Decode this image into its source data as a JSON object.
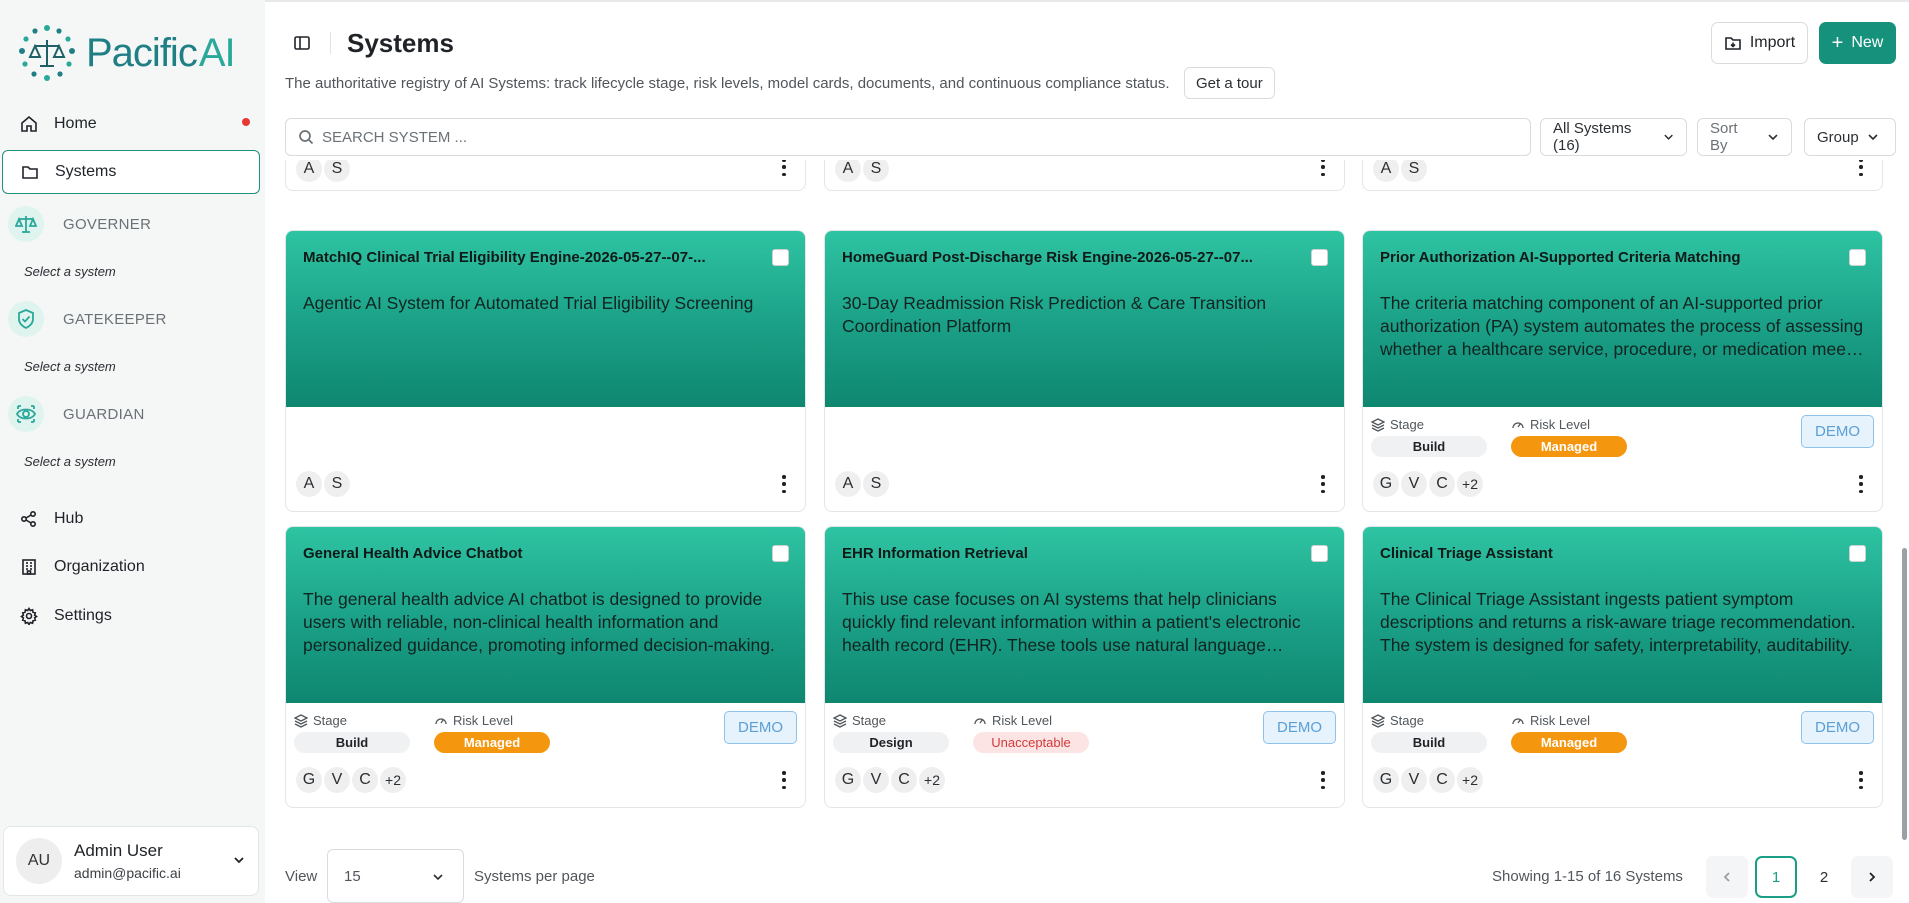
{
  "brand": {
    "name_part1": "Pacific",
    "name_part2": "AI"
  },
  "sidebar": {
    "nav": [
      {
        "label": "Home",
        "icon": "home-icon",
        "has_notification": true
      },
      {
        "label": "Systems",
        "icon": "folder-icon",
        "active": true
      }
    ],
    "modules": [
      {
        "label": "GOVERNER",
        "icon": "scale-icon",
        "sub": "Select a system"
      },
      {
        "label": "GATEKEEPER",
        "icon": "shield-check-icon",
        "sub": "Select a system"
      },
      {
        "label": "GUARDIAN",
        "icon": "eye-shield-icon",
        "sub": "Select a system"
      }
    ],
    "bottom_nav": [
      {
        "label": "Hub",
        "icon": "share-nodes-icon"
      },
      {
        "label": "Organization",
        "icon": "building-icon"
      },
      {
        "label": "Settings",
        "icon": "gear-icon"
      }
    ],
    "user": {
      "initials": "AU",
      "name": "Admin User",
      "email": "admin@pacific.ai"
    }
  },
  "header": {
    "title": "Systems",
    "description": "The authoritative registry of AI Systems: track lifecycle stage, risk levels, model cards, documents, and continuous compliance status.",
    "tour_label": "Get a tour",
    "import_label": "Import",
    "new_label": "New"
  },
  "filters": {
    "search_placeholder": "SEARCH SYSTEM ...",
    "systems_filter": "All Systems (16)",
    "sort_by": "Sort By",
    "group": "Group"
  },
  "cards_top_row_partial": [
    {
      "people": [
        "A",
        "S"
      ]
    },
    {
      "people": [
        "A",
        "S"
      ]
    },
    {
      "people": [
        "A",
        "S"
      ]
    }
  ],
  "cards": [
    {
      "title": "MatchIQ Clinical Trial Eligibility Engine-2026-05-27--07-...",
      "description": "Agentic AI System for Automated Trial Eligibility Screening",
      "people": [
        "A",
        "S"
      ]
    },
    {
      "title": "HomeGuard Post-Discharge Risk Engine-2026-05-27--07...",
      "description": "30-Day Readmission Risk Prediction & Care Transition Coordination Platform",
      "people": [
        "A",
        "S"
      ]
    },
    {
      "title": "Prior Authorization AI-Supported Criteria Matching",
      "description": "The criteria matching component of an AI-supported prior authorization (PA) system automates the process of assessing whether a healthcare service, procedure, or medication meets the payer's criteria.",
      "stage_label": "Stage",
      "stage": "Build",
      "risk_label": "Risk Level",
      "risk": "Managed",
      "risk_kind": "managed",
      "demo": "DEMO",
      "people": [
        "G",
        "V",
        "C",
        "+2"
      ]
    },
    {
      "title": "General Health Advice Chatbot",
      "description": "The general health advice AI chatbot is designed to provide users with reliable, non-clinical health information and personalized guidance, promoting informed decision-making.",
      "stage_label": "Stage",
      "stage": "Build",
      "risk_label": "Risk Level",
      "risk": "Managed",
      "risk_kind": "managed",
      "demo": "DEMO",
      "people": [
        "G",
        "V",
        "C",
        "+2"
      ]
    },
    {
      "title": "EHR Information Retrieval",
      "description": "This use case focuses on AI systems that help clinicians quickly find relevant information within a patient's electronic health record (EHR). These tools use natural language processing or search.",
      "stage_label": "Stage",
      "stage": "Design",
      "risk_label": "Risk Level",
      "risk": "Unacceptable",
      "risk_kind": "unacceptable",
      "demo": "DEMO",
      "people": [
        "G",
        "V",
        "C",
        "+2"
      ]
    },
    {
      "title": "Clinical Triage Assistant",
      "description": "The Clinical Triage Assistant ingests patient symptom descriptions and returns a risk-aware triage recommendation. The system is designed for safety, interpretability, auditability.",
      "stage_label": "Stage",
      "stage": "Build",
      "risk_label": "Risk Level",
      "risk": "Managed",
      "risk_kind": "managed",
      "demo": "DEMO",
      "people": [
        "G",
        "V",
        "C",
        "+2"
      ]
    }
  ],
  "pagination": {
    "view_label": "View",
    "per_page_value": "15",
    "per_page_label": "Systems per page",
    "showing": "Showing 1-15 of 16 Systems",
    "pages": [
      "1",
      "2"
    ],
    "current_page": "1"
  },
  "colors": {
    "accent": "#16917c",
    "card_gradient_top": "#2ec4a2",
    "card_gradient_bottom": "#0f8770",
    "managed": "#f5960f",
    "unacceptable_text": "#d03a3a"
  }
}
